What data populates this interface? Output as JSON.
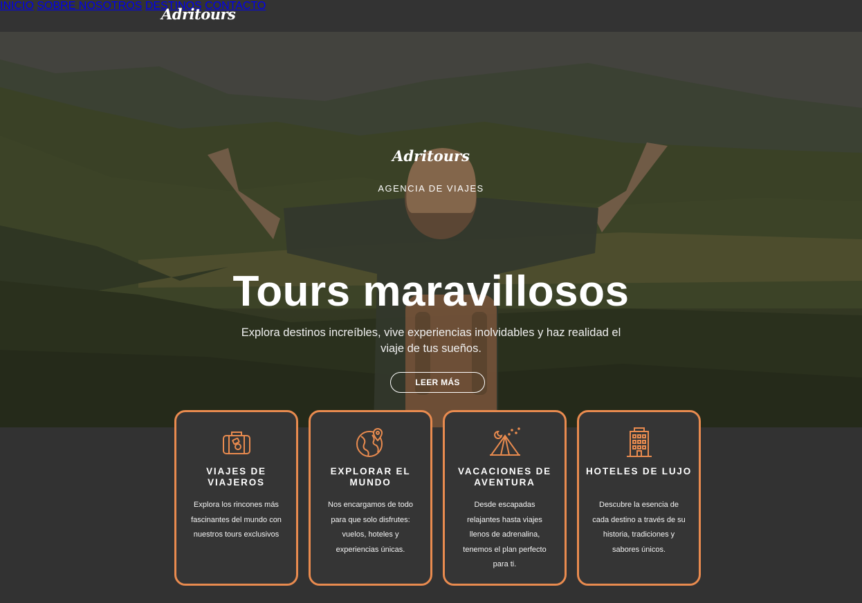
{
  "header": {
    "brand": "Adritours",
    "nav": [
      {
        "label": "INICIO",
        "active": true
      },
      {
        "label": "SOBRE NOSOTROS",
        "active": false
      },
      {
        "label": "DESTINOS",
        "active": false
      },
      {
        "label": "CONTACTO",
        "active": false
      }
    ]
  },
  "hero": {
    "logo": "Adritours",
    "subtitle": "AGENCIA DE VIAJES",
    "title": "Tours maravillosos",
    "description": "Explora destinos increíbles, vive experiencias inolvidables y haz realidad el viaje de tus sueños.",
    "button": "LEER MÁS"
  },
  "cards": [
    {
      "icon": "suitcase-icon",
      "title": "VIAJES DE VIAJEROS",
      "text": "Explora los rincones más fascinantes del mundo con nuestros tours exclusivos"
    },
    {
      "icon": "globe-pin-icon",
      "title": "EXPLORAR EL MUNDO",
      "text": "Nos encargamos de todo para que solo disfrutes: vuelos, hoteles y experiencias únicas."
    },
    {
      "icon": "tent-icon",
      "title": "VACACIONES DE AVENTURA",
      "text": "Desde escapadas relajantes hasta viajes llenos de adrenalina, tenemos el plan perfecto para ti."
    },
    {
      "icon": "hotel-building-icon",
      "title": "HOTELES DE LUJO",
      "text": "Descubre la esencia de cada destino a través de su historia, tradiciones y sabores únicos."
    }
  ],
  "colors": {
    "accent": "#e98b4f",
    "dark": "#333333"
  }
}
